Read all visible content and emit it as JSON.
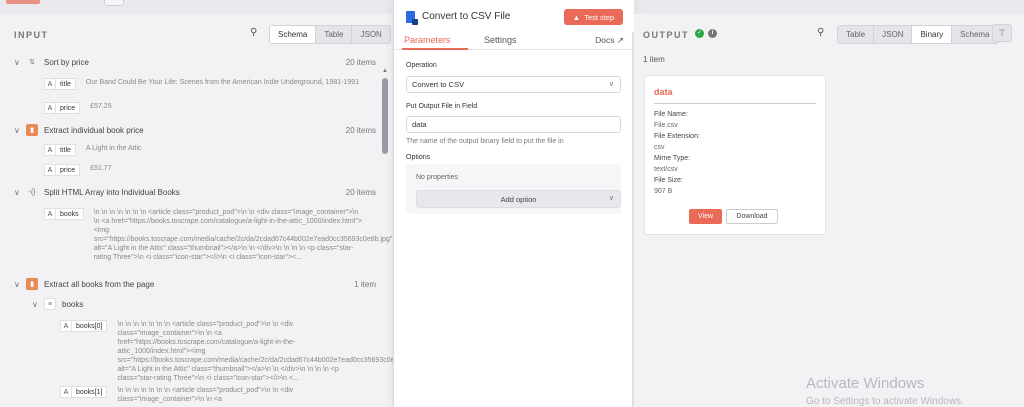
{
  "input": {
    "title": "INPUT",
    "view_tabs": [
      "Schema",
      "Table",
      "JSON"
    ],
    "nodes": [
      {
        "name": "Sort by price",
        "count": "20 items",
        "fields": [
          {
            "type": "A",
            "key": "title",
            "value": "Our Band Could Be Your Life: Scenes from the American Indie Underground, 1981-1991"
          },
          {
            "type": "A",
            "key": "price",
            "value": "£57.25"
          }
        ]
      },
      {
        "name": "Extract individual book price",
        "count": "20 items",
        "fields": [
          {
            "type": "A",
            "key": "title",
            "value": "A Light in the Attic"
          },
          {
            "type": "A",
            "key": "price",
            "value": "£51.77"
          }
        ]
      },
      {
        "name": "Split HTML Array into Individual Books",
        "count": "20 items",
        "fields": [
          {
            "type": "A",
            "key": "books",
            "value": "\\n \\n \\n \\n \\n \\n \\n <article class=\"product_pod\">\\n \\n <div class=\"image_container\">\\n \\n <a href=\"https://books.toscrape.com/catalogue/a-light-in-the-attic_1000/index.html\"><img src=\"https://books.toscrape.com/media/cache/2c/da/2cdad67c44b002e7ead0cc35693c0e8b.jpg\" alt=\"A Light in the Attic\" class=\"thumbnail\"></a>\\n \\n </div>\\n \\n \\n \\n <p class=\"star-rating Three\">\\n <i class=\"icon-star\"></i>\\n <i class=\"icon-star\"><..."
          }
        ]
      },
      {
        "name": "Extract all books from the page",
        "count": "1 item",
        "subgroup": "books",
        "fields": [
          {
            "type": "A",
            "key": "books[0]",
            "value": "\\n \\n \\n \\n \\n \\n \\n <article class=\"product_pod\">\\n \\n <div class=\"image_container\">\\n \\n <a href=\"https://books.toscrape.com/catalogue/a-light-in-the-attic_1000/index.html\"><img src=\"https://books.toscrape.com/media/cache/2c/da/2cdad67c44b002e7ead0cc35693c0e8b.jpg\" alt=\"A Light in the Attic\" class=\"thumbnail\"></a>\\n \\n </div>\\n \\n \\n \\n <p class=\"star-rating Three\">\\n <i class=\"icon-star\"></i>\\n <..."
          },
          {
            "type": "A",
            "key": "books[1]",
            "value": "\\n \\n \\n \\n \\n \\n \\n <article class=\"product_pod\">\\n \\n <div class=\"image_container\">\\n \\n <a"
          }
        ]
      }
    ]
  },
  "modal": {
    "title": "Convert to CSV File",
    "test_button": "Test step",
    "tabs": [
      "Parameters",
      "Settings"
    ],
    "docs": "Docs",
    "operation_label": "Operation",
    "operation_value": "Convert to CSV",
    "output_field_label": "Put Output File in Field",
    "output_field_value": "data",
    "output_field_hint": "The name of the output binary field to put the file in",
    "options_label": "Options",
    "no_properties": "No properties",
    "add_option": "Add option"
  },
  "output": {
    "title": "OUTPUT",
    "view_tabs": [
      "Table",
      "JSON",
      "Binary",
      "Schema"
    ],
    "item_count": "1 item",
    "card": {
      "title": "data",
      "file_name_label": "File Name:",
      "file_name": "File.csv",
      "ext_label": "File Extension:",
      "ext": "csv",
      "mime_label": "Mime Type:",
      "mime": "text/csv",
      "size_label": "File Size:",
      "size": "907 B",
      "view": "View",
      "download": "Download"
    }
  },
  "watermark": {
    "line1": "Activate Windows",
    "line2": "Go to Settings to activate Windows."
  },
  "colors": {
    "accent": "#ea6a58",
    "success": "#28a745",
    "csv_icon": "#2b6be1"
  }
}
